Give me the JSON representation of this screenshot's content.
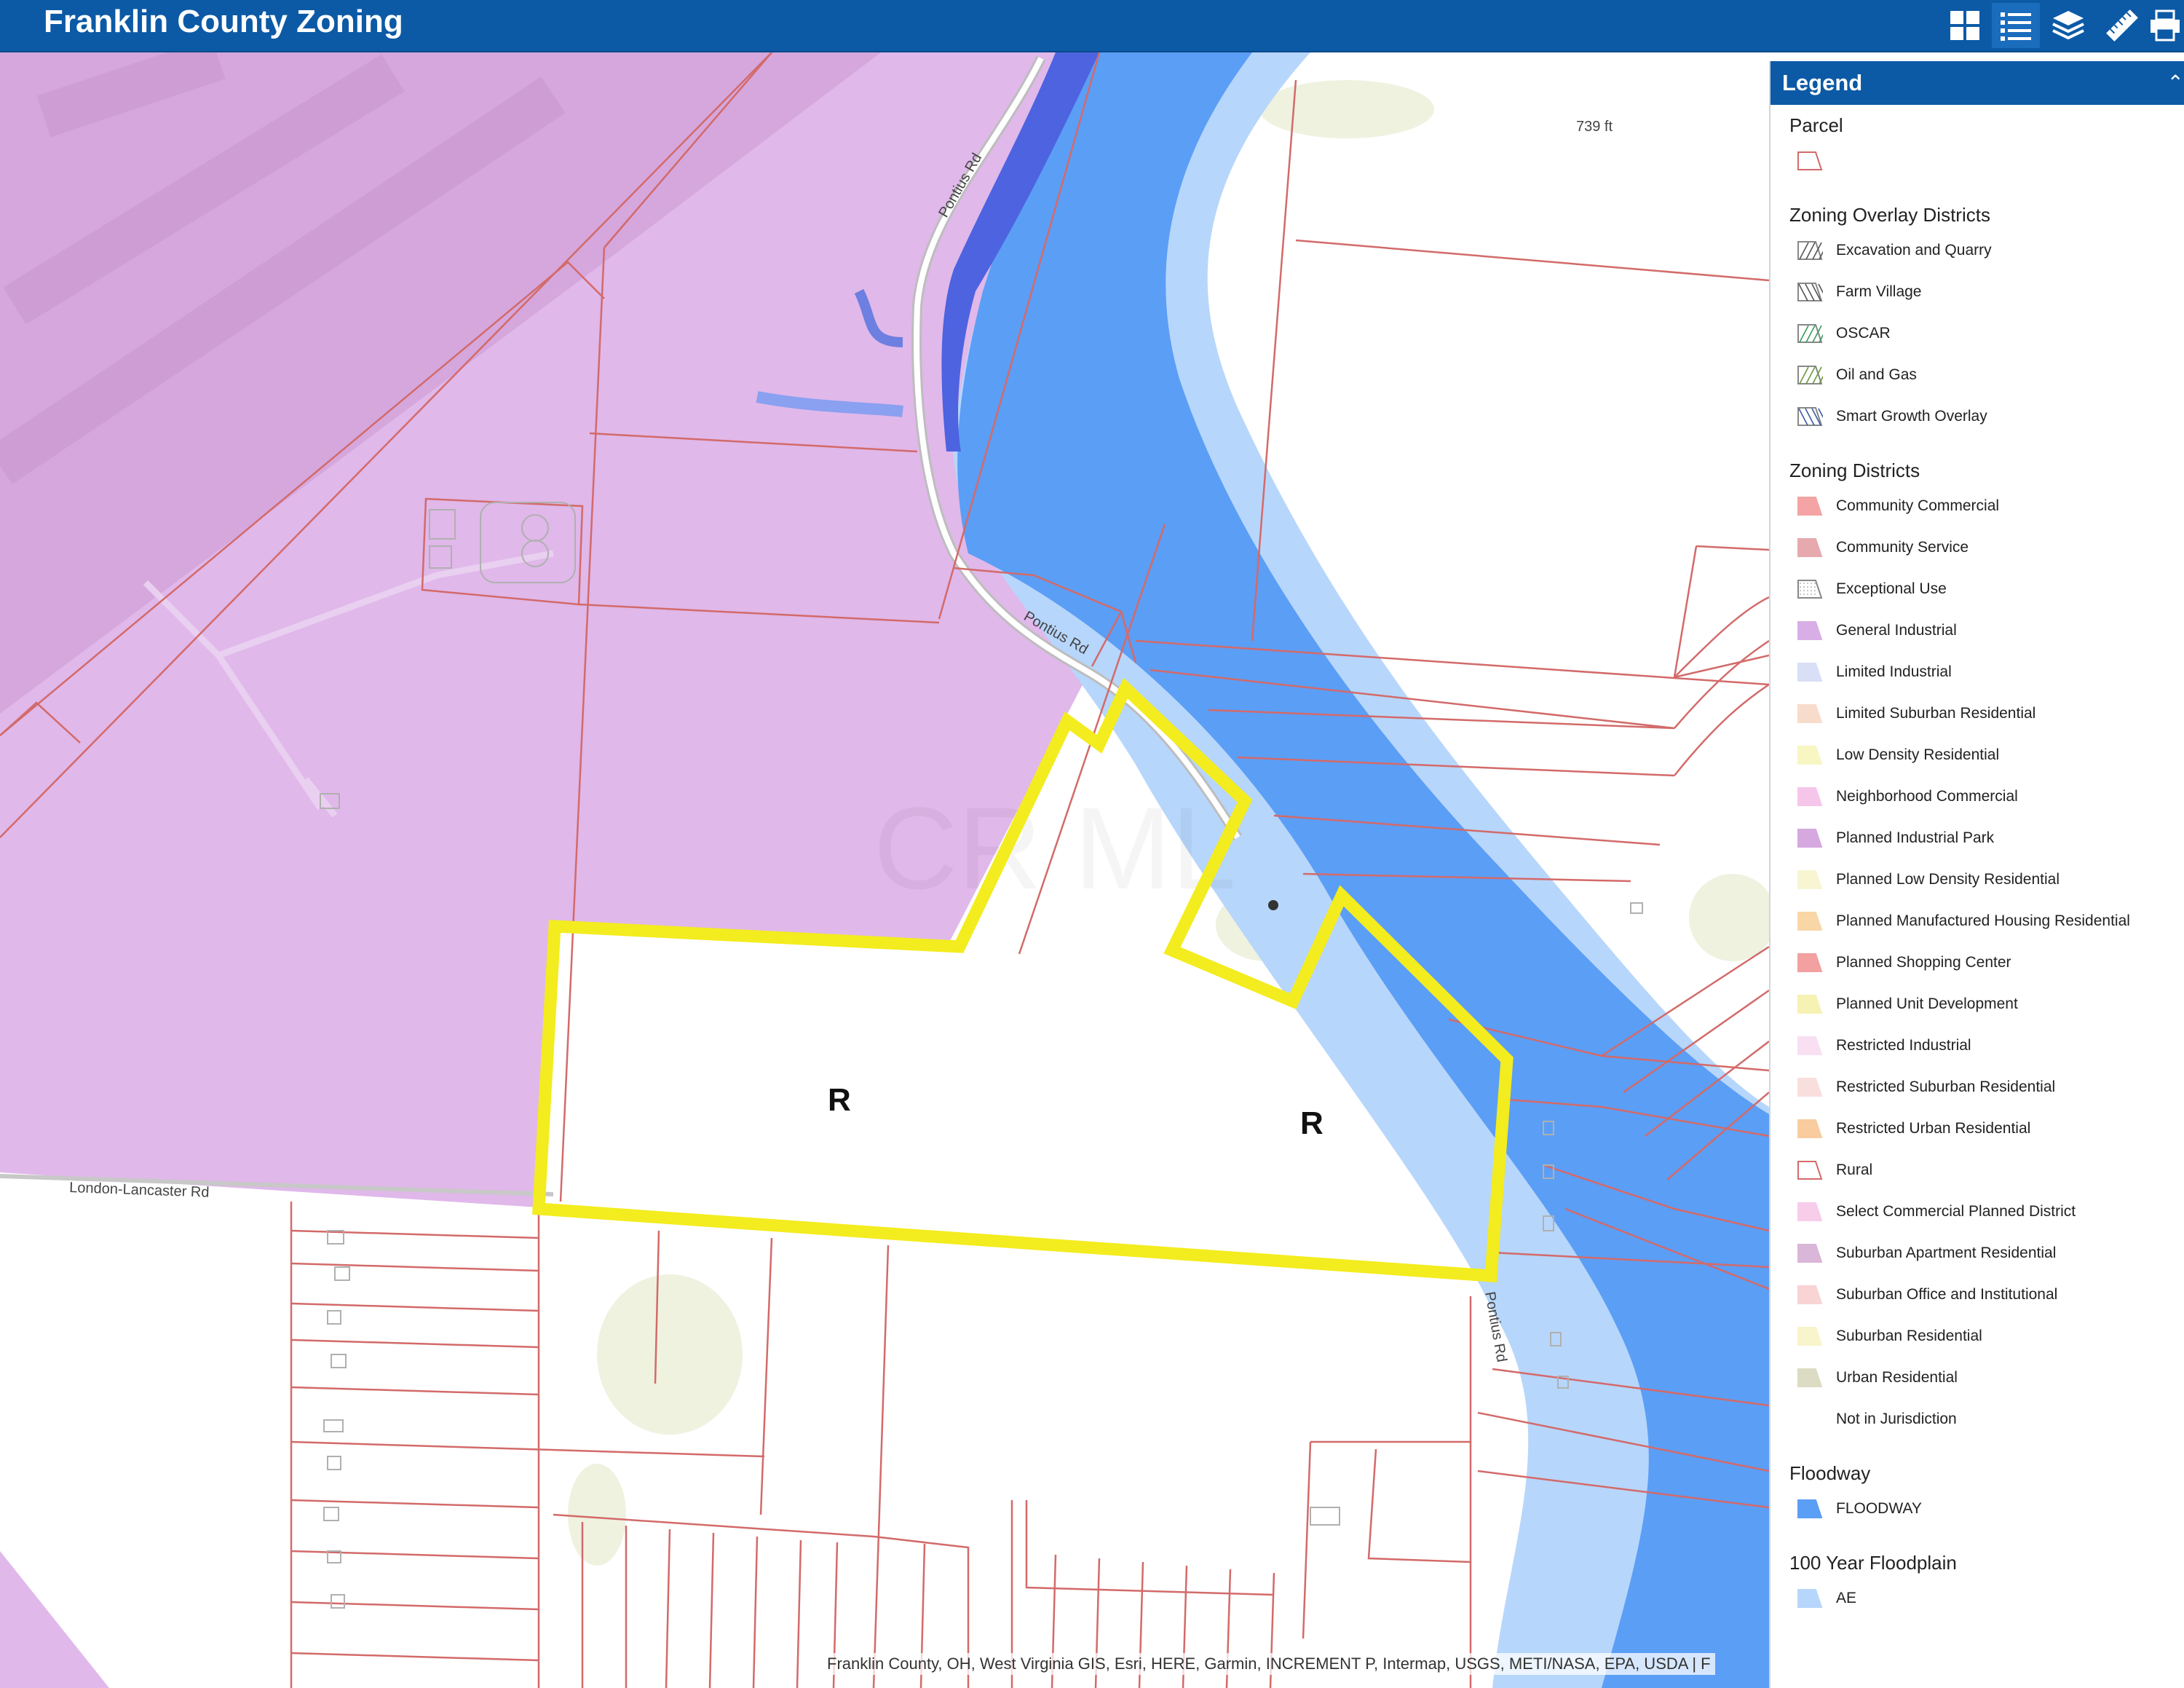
{
  "header": {
    "title": "Franklin County Zoning",
    "tools": [
      {
        "name": "basemap-gallery-icon"
      },
      {
        "name": "legend-list-icon"
      },
      {
        "name": "layers-icon"
      },
      {
        "name": "measure-ruler-icon"
      },
      {
        "name": "print-icon"
      }
    ]
  },
  "map": {
    "zone_labels": [
      "R",
      "R"
    ],
    "road_labels": [
      "London-Lancaster Rd",
      "Pontius Rd",
      "Pontius Rd",
      "Pontius Rd"
    ],
    "elevation_label": "739 ft",
    "watermark": "CR ML",
    "attribution": "Franklin County, OH, West Virginia GIS, Esri, HERE, Garmin, INCREMENT P, Intermap, USGS, METI/NASA, EPA, USDA | F",
    "colors": {
      "general_industrial": "#e0b8ea",
      "floodway": "#5b9ef5",
      "floodplain": "#b7d6fb",
      "parcel_line": "#d36a6a",
      "highlight": "#f3ec1f"
    }
  },
  "legend": {
    "title": "Legend",
    "sections": [
      {
        "title": "Parcel",
        "items": [
          {
            "label": "",
            "swatch": "parcel",
            "color": "#ffffff"
          }
        ]
      },
      {
        "title": "Zoning Overlay Districts",
        "items": [
          {
            "label": "Excavation and Quarry",
            "swatch": "hatch",
            "color": "#555555"
          },
          {
            "label": "Farm Village",
            "swatch": "hatch2",
            "color": "#555555"
          },
          {
            "label": "OSCAR",
            "swatch": "hatch",
            "color": "#3a9a5a"
          },
          {
            "label": "Oil and Gas",
            "swatch": "hatch",
            "color": "#6a9a3a"
          },
          {
            "label": "Smart Growth Overlay",
            "swatch": "hatch2",
            "color": "#3a5aa0"
          }
        ]
      },
      {
        "title": "Zoning Districts",
        "items": [
          {
            "label": "Community Commercial",
            "swatch": "fill",
            "color": "#f4a4a4"
          },
          {
            "label": "Community Service",
            "swatch": "fill",
            "color": "#e6a9ad"
          },
          {
            "label": "Exceptional Use",
            "swatch": "dots",
            "color": "#888888"
          },
          {
            "label": "General Industrial",
            "swatch": "fill",
            "color": "#d8aee6"
          },
          {
            "label": "Limited Industrial",
            "swatch": "fill",
            "color": "#d9dff6"
          },
          {
            "label": "Limited Suburban Residential",
            "swatch": "fill",
            "color": "#f8dccb"
          },
          {
            "label": "Low Density Residential",
            "swatch": "fill",
            "color": "#f8f6c2"
          },
          {
            "label": "Neighborhood Commercial",
            "swatch": "fill",
            "color": "#f6c6ea"
          },
          {
            "label": "Planned Industrial Park",
            "swatch": "fill",
            "color": "#d6a8e0"
          },
          {
            "label": "Planned Low Density Residential",
            "swatch": "fill",
            "color": "#f8f6d2"
          },
          {
            "label": "Planned Manufactured Housing Residential",
            "swatch": "fill",
            "color": "#f9d6a6"
          },
          {
            "label": "Planned Shopping Center",
            "swatch": "fill",
            "color": "#f2a0a0"
          },
          {
            "label": "Planned Unit Development",
            "swatch": "fill",
            "color": "#f6f2b4"
          },
          {
            "label": "Restricted Industrial",
            "swatch": "fill",
            "color": "#f8e0f2"
          },
          {
            "label": "Restricted Suburban Residential",
            "swatch": "fill",
            "color": "#f9dede"
          },
          {
            "label": "Restricted Urban Residential",
            "swatch": "fill",
            "color": "#f8cc9e"
          },
          {
            "label": "Rural",
            "swatch": "parcel",
            "color": "#ffffff"
          },
          {
            "label": "Select Commercial Planned District",
            "swatch": "fill",
            "color": "#f7cdea"
          },
          {
            "label": "Suburban Apartment Residential",
            "swatch": "fill",
            "color": "#dab6d8"
          },
          {
            "label": "Suburban Office and Institutional",
            "swatch": "fill",
            "color": "#f8d4d4"
          },
          {
            "label": "Suburban Residential",
            "swatch": "fill",
            "color": "#f8f4cc"
          },
          {
            "label": "Urban Residential",
            "swatch": "fill",
            "color": "#dcdcc4"
          },
          {
            "label": "Not in Jurisdiction",
            "swatch": "none",
            "color": "#ffffff"
          }
        ]
      },
      {
        "title": "Floodway",
        "items": [
          {
            "label": "FLOODWAY",
            "swatch": "fill",
            "color": "#5b9ef5"
          }
        ]
      },
      {
        "title": "100 Year Floodplain",
        "items": [
          {
            "label": "AE",
            "swatch": "fill",
            "color": "#b7d6fb"
          }
        ]
      }
    ]
  }
}
